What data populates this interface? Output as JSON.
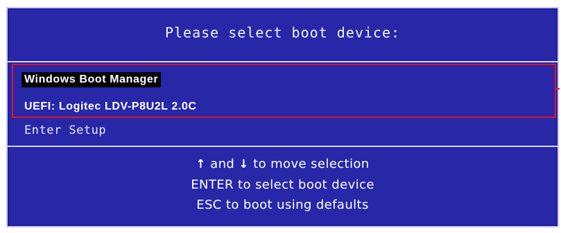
{
  "header": {
    "title": "Please select boot device:"
  },
  "devices": [
    {
      "label": "Windows Boot Manager",
      "selected": true
    },
    {
      "label": "UEFI: Logitec  LDV-P8U2L  2.0C",
      "selected": false
    }
  ],
  "enter_setup": "Enter Setup",
  "help": {
    "line1_arrow_up": "↑",
    "line1_and": " and ",
    "line1_arrow_down": "↓",
    "line1_rest": " to move selection",
    "line2": "ENTER to select boot device",
    "line3": "ESC to boot using defaults"
  },
  "colors": {
    "background": "#2727a8",
    "highlight_border": "#e0142a",
    "selected_bg": "#050505",
    "text": "#ffffff"
  }
}
